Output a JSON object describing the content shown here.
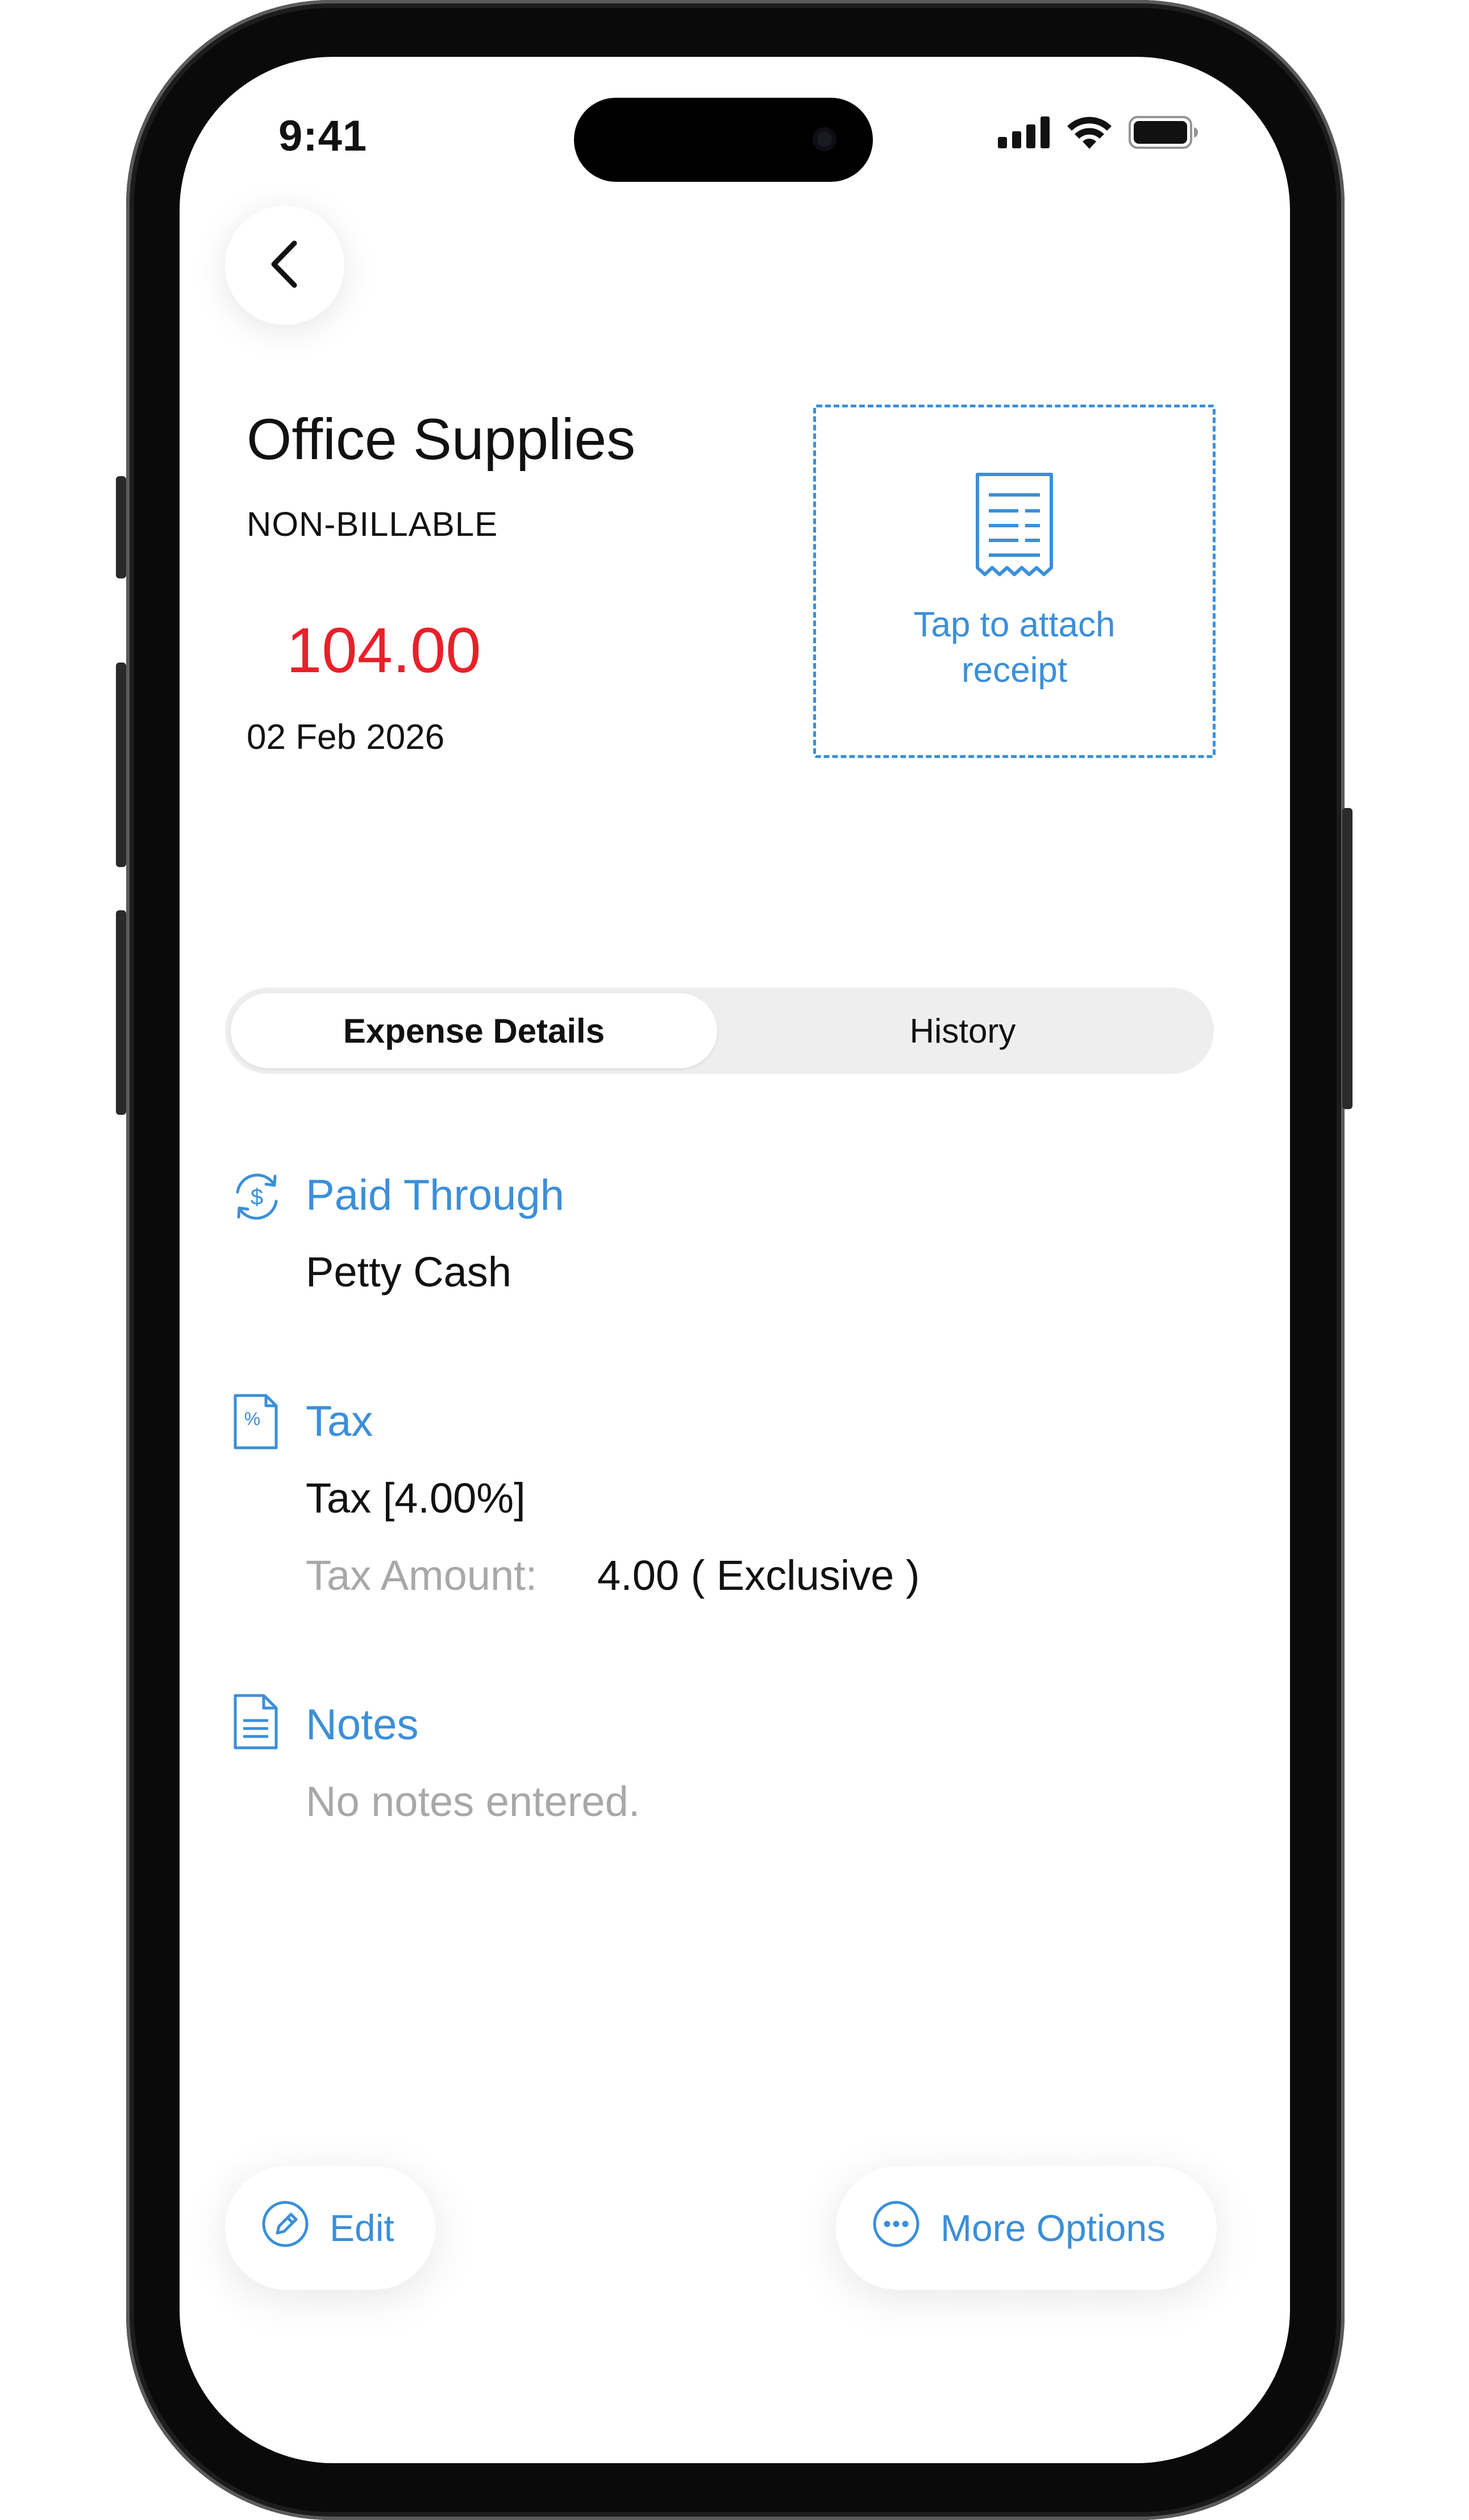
{
  "status_bar": {
    "time": "9:41",
    "icons": [
      "signal-icon",
      "wifi-icon",
      "battery-icon"
    ]
  },
  "nav": {
    "back_icon": "chevron-left-icon"
  },
  "expense": {
    "title": "Office Supplies",
    "billable_status": "NON-BILLABLE",
    "amount": "104.00",
    "date": "02 Feb 2026"
  },
  "receipt": {
    "icon": "receipt-icon",
    "label": "Tap to attach receipt"
  },
  "tabs": [
    {
      "label": "Expense Details",
      "active": true
    },
    {
      "label": "History",
      "active": false
    }
  ],
  "sections": {
    "paid_through": {
      "icon": "currency-exchange-icon",
      "title": "Paid Through",
      "value": "Petty Cash"
    },
    "tax": {
      "icon": "tax-document-icon",
      "title": "Tax",
      "value": "Tax [4.00%]",
      "amount_label": "Tax Amount:",
      "amount_value": "4.00 ( Exclusive )"
    },
    "notes": {
      "icon": "notes-document-icon",
      "title": "Notes",
      "value": "No notes entered."
    }
  },
  "actions": {
    "edit_label": "Edit",
    "edit_icon": "pencil-circle-icon",
    "more_label": "More Options",
    "more_icon": "ellipsis-circle-icon"
  },
  "colors": {
    "accent": "#3b8fd9",
    "amount": "#e8202a",
    "muted_text": "#a8a8a8",
    "tab_track": "#eeeeee"
  }
}
